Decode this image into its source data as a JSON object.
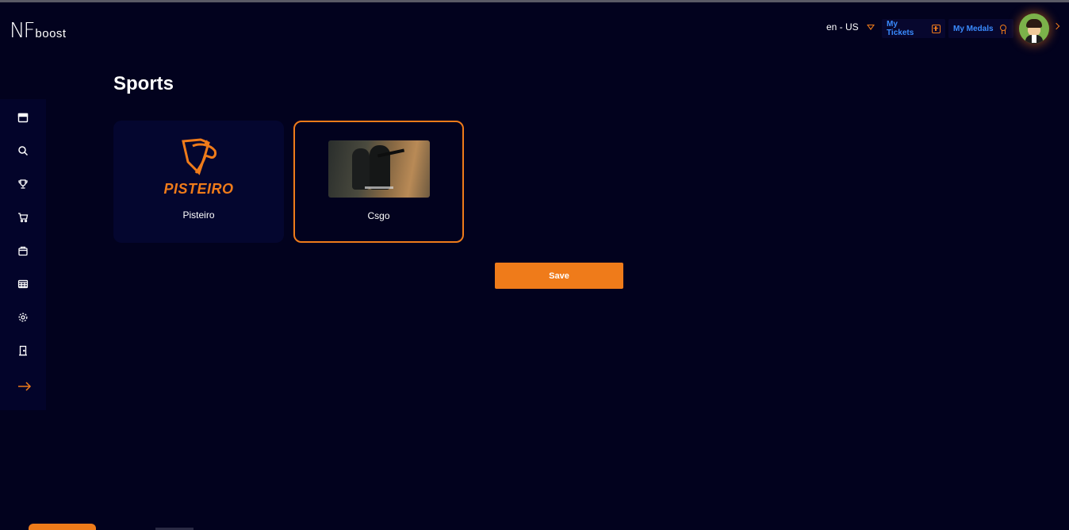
{
  "header": {
    "logo_main": "NF",
    "logo_sub": "boost",
    "language": "en - US",
    "my_tickets": "My Tickets",
    "my_medals": "My Medals"
  },
  "sidebar": {
    "items": [
      {
        "icon": "calendar-icon"
      },
      {
        "icon": "search-icon"
      },
      {
        "icon": "trophy-icon"
      },
      {
        "icon": "cart-icon"
      },
      {
        "icon": "bag-icon"
      },
      {
        "icon": "table-icon"
      },
      {
        "icon": "gear-icon"
      },
      {
        "icon": "door-icon"
      },
      {
        "icon": "arrow-right-icon"
      }
    ]
  },
  "main": {
    "title": "Sports",
    "sports": [
      {
        "name": "Pisteiro",
        "logo_text": "PISTEIRO",
        "selected": false
      },
      {
        "name": "Csgo",
        "selected": true
      }
    ],
    "save_label": "Save"
  },
  "colors": {
    "background": "#02021e",
    "accent": "#ef7b1a",
    "link_blue": "#3a8cff"
  }
}
